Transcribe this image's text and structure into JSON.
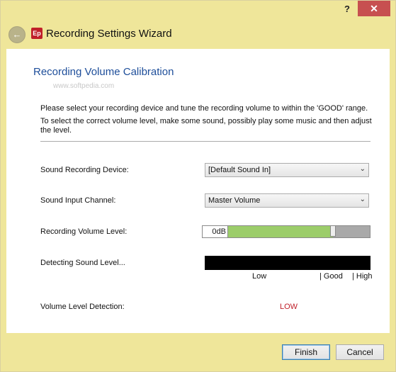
{
  "titlebar": {
    "help_label": "?",
    "close_label": "✕"
  },
  "header": {
    "back_icon": "arrow-left-icon",
    "app_icon_text": "Ep",
    "title": "Recording Settings Wizard"
  },
  "page": {
    "title": "Recording Volume Calibration",
    "watermark": "www.softpedia.com",
    "instruction_1": "Please select your recording device and tune the recording volume to within the 'GOOD' range.",
    "instruction_2": "To select the correct volume level, make some sound, possibly play some music and then adjust the level."
  },
  "form": {
    "device_label": "Sound Recording Device:",
    "device_value": "[Default Sound In]",
    "channel_label": "Sound Input Channel:",
    "channel_value": "Master Volume",
    "volume_label": "Recording Volume Level:",
    "volume_value": "0dB",
    "volume_fraction": 0.78,
    "detecting_label": "Detecting Sound Level...",
    "scale": {
      "low": "Low",
      "good": "| Good",
      "high": "| High"
    },
    "detection_label": "Volume Level Detection:",
    "detection_value": "LOW"
  },
  "buttons": {
    "finish": "Finish",
    "cancel": "Cancel"
  },
  "colors": {
    "accent": "#1e4e9a",
    "warning": "#c0202a",
    "slider_fill": "#9ccd6a",
    "frame": "#efe69a"
  }
}
